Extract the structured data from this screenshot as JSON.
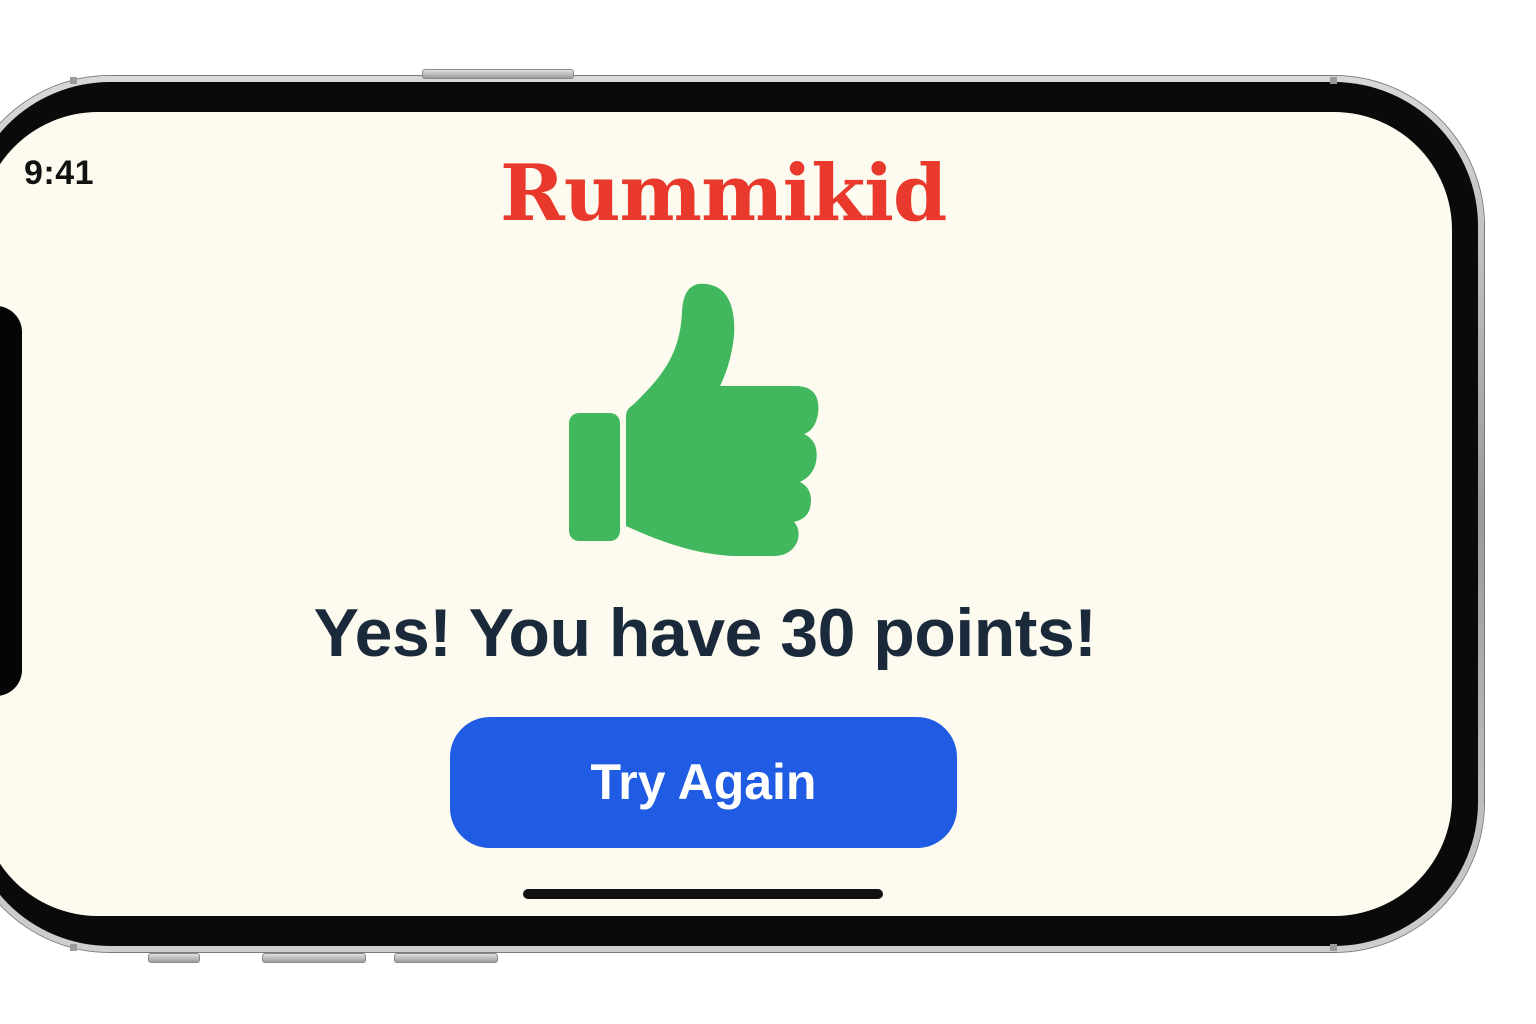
{
  "status_bar": {
    "time": "9:41"
  },
  "app": {
    "title": "Rummikid",
    "title_color": "#e8392c"
  },
  "result": {
    "icon": "thumbs-up-icon",
    "icon_color": "#41b75e",
    "message": "Yes! You have 30 points!"
  },
  "actions": {
    "try_again_label": "Try Again",
    "button_color": "#1f5be3"
  },
  "theme": {
    "screen_background": "#fdfbf0",
    "text_color": "#1b2a3b"
  }
}
